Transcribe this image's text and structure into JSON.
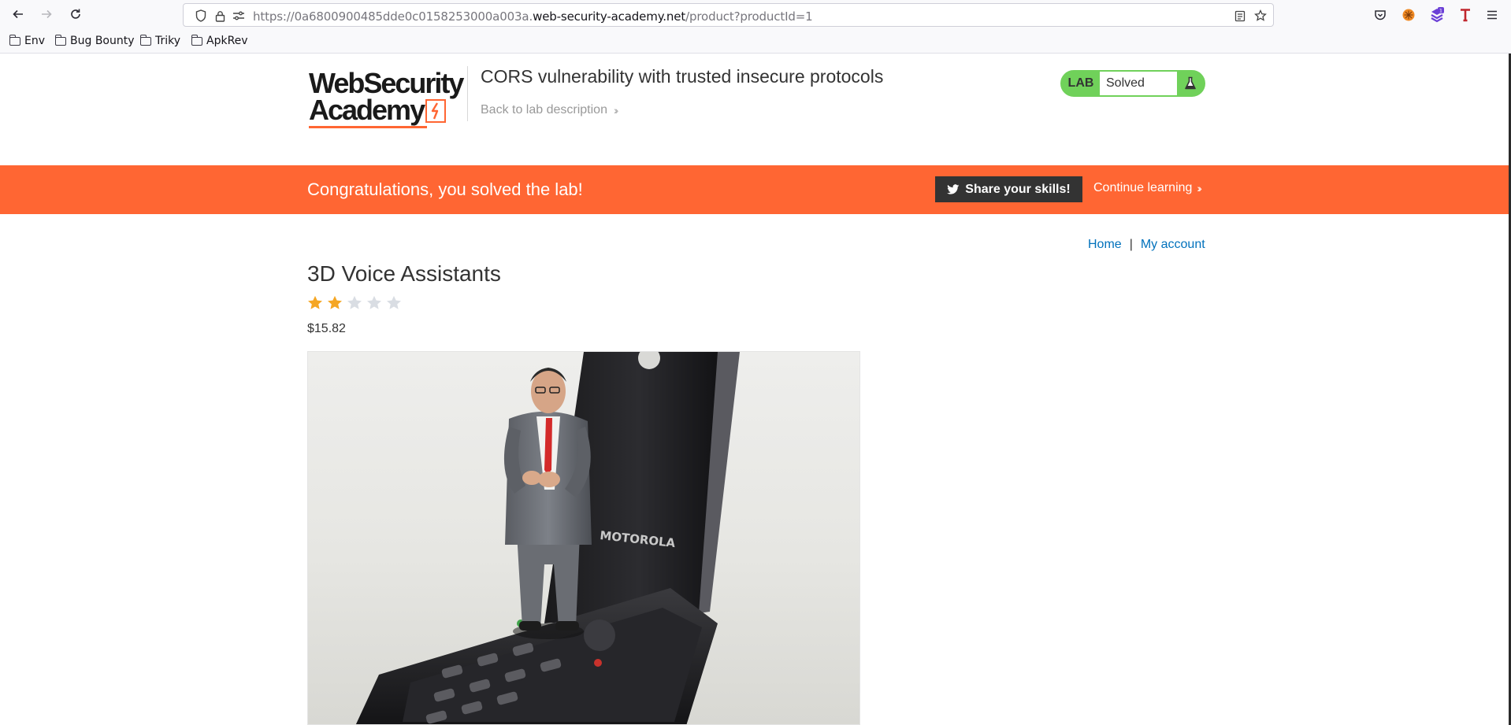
{
  "browser": {
    "url_prefix": "https://0a6800900485dde0c0158253000a003a.",
    "url_host": "web-security-academy.net",
    "url_path": "/product?productId=1",
    "extension_badge": "1",
    "bookmarks": [
      "Env",
      "Bug Bounty",
      "Triky",
      "ApkRev"
    ]
  },
  "header": {
    "logo_line1": "WebSecurity",
    "logo_line2": "Academy",
    "lab_title": "CORS vulnerability with trusted insecure protocols",
    "back_link": "Back to lab description",
    "lab_tag": "LAB",
    "lab_state": "Solved"
  },
  "banner": {
    "message": "Congratulations, you solved the lab!",
    "share_button": "Share your skills!",
    "continue_link": "Continue learning"
  },
  "nav": {
    "home": "Home",
    "separator": "|",
    "my_account": "My account"
  },
  "product": {
    "title": "3D Voice Assistants",
    "rating": 2,
    "rating_max": 5,
    "price": "$15.82",
    "phone_brand": "MOTOROLA"
  },
  "colors": {
    "accent_orange": "#ff6633",
    "lab_green": "#70d15a",
    "link_blue": "#0071bc",
    "star_gold": "#f5a623",
    "star_grey": "#d9dde3"
  }
}
